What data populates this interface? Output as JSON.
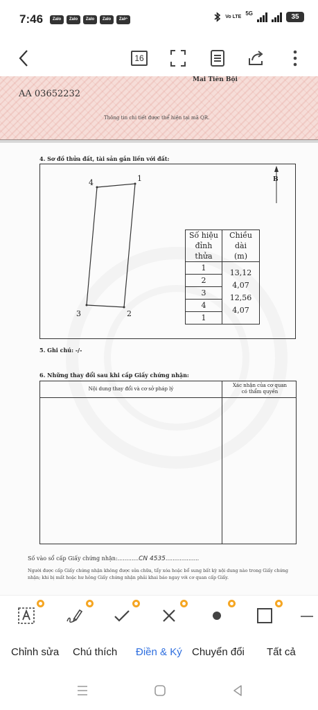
{
  "status": {
    "time": "7:46",
    "zalo_label": "Zalo",
    "volte": "Vo LTE",
    "five_g": "5G",
    "battery": "35"
  },
  "toolbar": {
    "page_number": "16"
  },
  "certificate": {
    "signer": "Mai Tiên Bội",
    "code": "AA 03652232",
    "qr_note": "Thông tin chi tiết được thể hiện tại mã QR."
  },
  "section4": {
    "title": "4. Sơ đồ thửa đất, tài sản gắn liền với đất:",
    "north": "B",
    "points": [
      "4",
      "1",
      "3",
      "2"
    ],
    "table": {
      "header_col1": [
        "Số hiệu",
        "đỉnh thửa"
      ],
      "header_col2": [
        "Chiều dài",
        "(m)"
      ],
      "vertices": [
        "1",
        "2",
        "3",
        "4",
        "1"
      ],
      "lengths": [
        "13,12",
        "4,07",
        "12,56",
        "4,07"
      ]
    }
  },
  "section5": {
    "title": "5. Ghi chú: -/-"
  },
  "section6": {
    "title": "6. Những thay đổi sau khi cấp Giấy chứng nhận:",
    "col1": "Nội dung thay đổi và cơ sở pháp lý",
    "col2_line1": "Xác nhận của cơ quan",
    "col2_line2": "có thẩm quyền"
  },
  "registry": {
    "label": "Số vào sổ cấp Giấy chứng nhận:............",
    "handwritten": "CN 4535",
    "dots": "..................."
  },
  "footer_note": "Người được cấp Giấy chứng nhận không được sửa chữa, tẩy xóa hoặc bổ sung bất kỳ nội dung nào trong Giấy chứng nhận; khi bị mất hoặc hư hỏng Giấy chứng nhận phải khai báo ngay với cơ quan cấp Giấy.",
  "tabs": [
    "Chỉnh sửa",
    "Chú thích",
    "Điền & Ký",
    "Chuyển đổi",
    "Tất cả"
  ],
  "active_tab": "Điền & Ký",
  "colors": {
    "accent": "#2f6fdf",
    "badge": "#f5a623",
    "certificate_band": "#f6ddd8"
  }
}
